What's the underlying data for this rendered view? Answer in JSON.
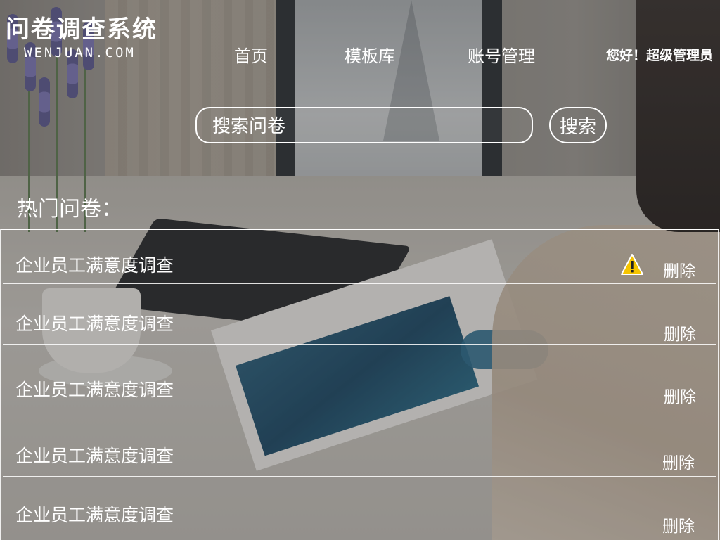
{
  "header": {
    "logo_title": "问卷调查系统",
    "logo_subtitle": "WENJUAN.COM",
    "nav": {
      "home": "首页",
      "templates": "模板库",
      "account": "账号管理"
    },
    "greeting": "您好！超级管理员"
  },
  "search": {
    "placeholder": "搜索问卷",
    "button_label": "搜索"
  },
  "hot": {
    "title": "热门问卷：",
    "items": [
      {
        "title": "企业员工满意度调查",
        "delete_label": "删除",
        "warning": true
      },
      {
        "title": "企业员工满意度调查",
        "delete_label": "删除",
        "warning": false
      },
      {
        "title": "企业员工满意度调查",
        "delete_label": "删除",
        "warning": false
      },
      {
        "title": "企业员工满意度调查",
        "delete_label": "删除",
        "warning": false
      },
      {
        "title": "企业员工满意度调查",
        "delete_label": "删除",
        "warning": false
      }
    ]
  },
  "icons": {
    "warning": "warning-icon"
  },
  "colors": {
    "text": "#ffffff",
    "warning": "#f5c400"
  }
}
